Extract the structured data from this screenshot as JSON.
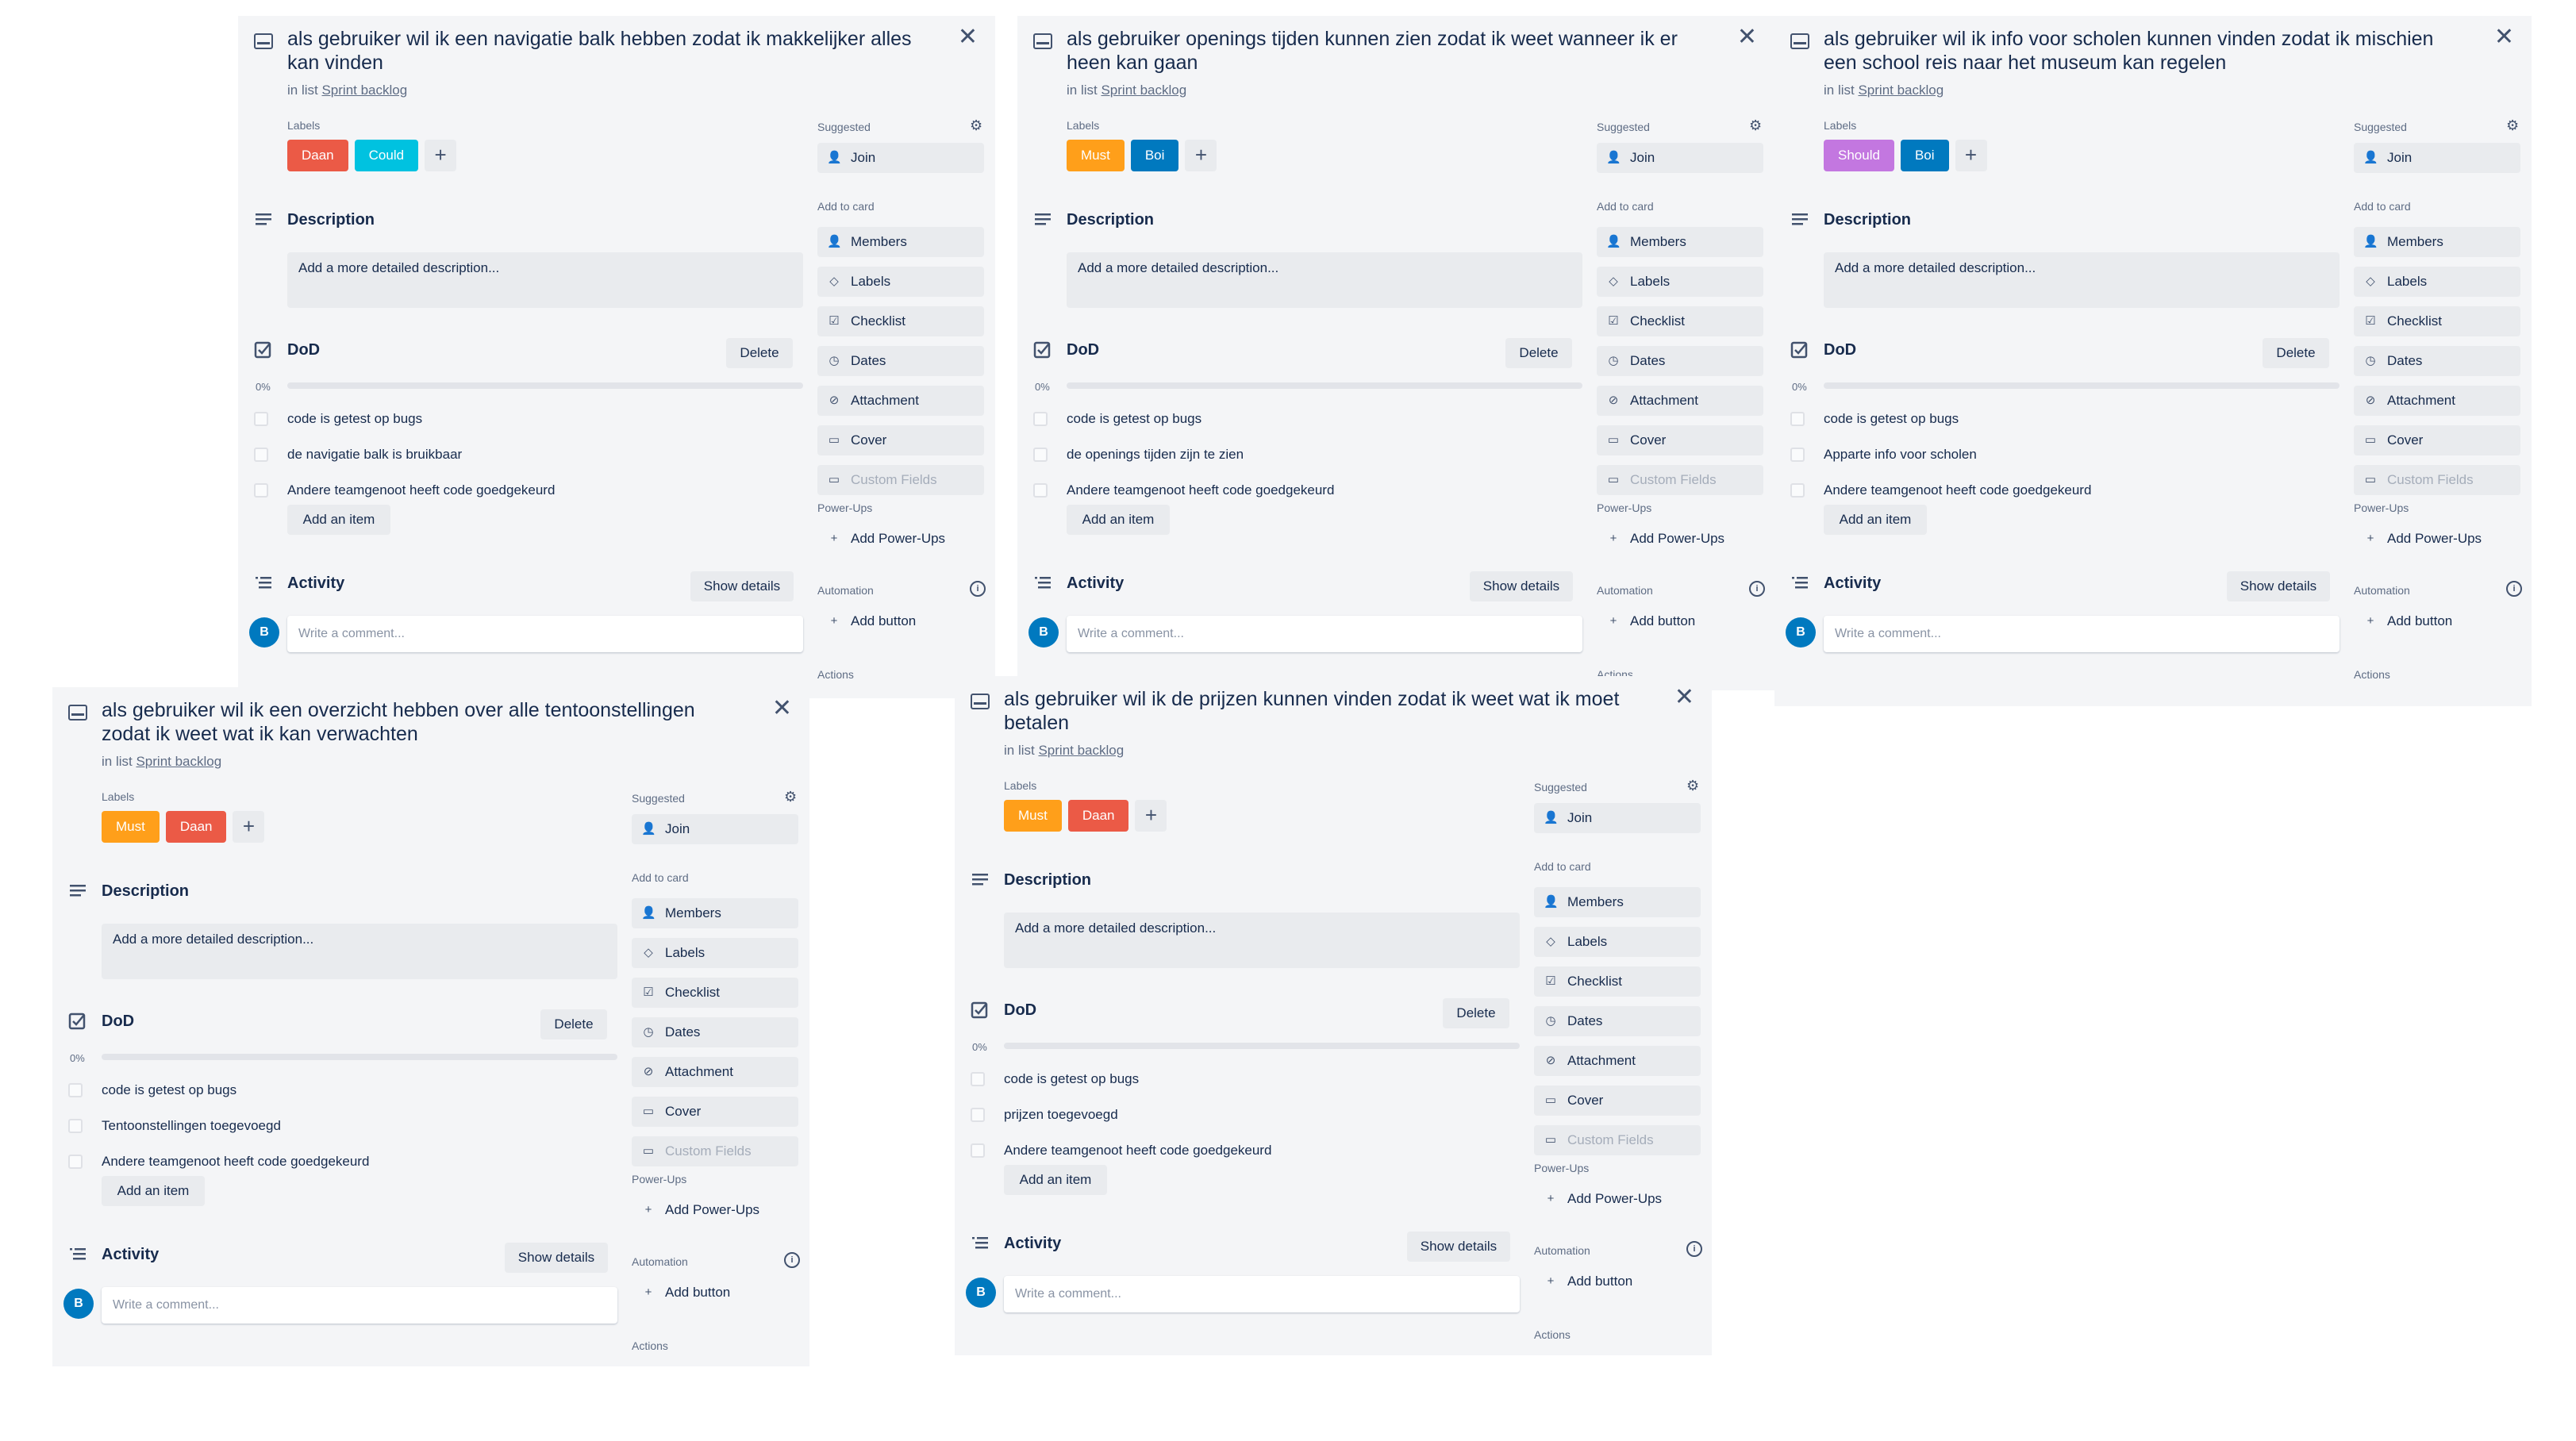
{
  "colors": {
    "Daan": "#eb5a46",
    "Could": "#00c2e0",
    "Must": "#ff9f1a",
    "Boi": "#0079bf",
    "Should": "#c377e0"
  },
  "cards": [
    {
      "title": "als gebruiker wil ik een navigatie balk hebben zodat ik makkelijker alles kan vinden",
      "list_prefix": "in list",
      "list_name": "Sprint backlog",
      "labels_caption": "Labels",
      "labels": [
        "Daan",
        "Could"
      ],
      "description_title": "Description",
      "description_placeholder": "Add a more detailed description...",
      "checklist_title": "DoD",
      "delete_label": "Delete",
      "progress_text": "0%",
      "progress": 0,
      "items": [
        "code is getest op bugs",
        "de navigatie balk is bruikbaar",
        "Andere teamgenoot heeft code goedgekeurd"
      ],
      "add_item": "Add an item",
      "activity_title": "Activity",
      "show_details": "Show details",
      "avatar": "B",
      "comment_placeholder": "Write a comment...",
      "side": {
        "suggested": "Suggested",
        "join": "Join",
        "add_to_card": "Add to card",
        "buttons": [
          "Members",
          "Labels",
          "Checklist",
          "Dates",
          "Attachment",
          "Cover",
          "Custom Fields"
        ],
        "powerups": "Power-Ups",
        "add_powerups": "Add Power-Ups",
        "automation": "Automation",
        "add_button": "Add button",
        "actions": "Actions"
      }
    },
    {
      "title": "als gebruiker openings tijden kunnen zien zodat ik weet wanneer ik er heen kan gaan",
      "list_prefix": "in list",
      "list_name": "Sprint backlog",
      "labels_caption": "Labels",
      "labels": [
        "Must",
        "Boi"
      ],
      "description_title": "Description",
      "description_placeholder": "Add a more detailed description...",
      "checklist_title": "DoD",
      "delete_label": "Delete",
      "progress_text": "0%",
      "progress": 0,
      "items": [
        "code is getest op bugs",
        "de openings tijden zijn te zien",
        "Andere teamgenoot heeft code goedgekeurd"
      ],
      "add_item": "Add an item",
      "activity_title": "Activity",
      "show_details": "Show details",
      "avatar": "B",
      "comment_placeholder": "Write a comment...",
      "side": {
        "suggested": "Suggested",
        "join": "Join",
        "add_to_card": "Add to card",
        "buttons": [
          "Members",
          "Labels",
          "Checklist",
          "Dates",
          "Attachment",
          "Cover",
          "Custom Fields"
        ],
        "powerups": "Power-Ups",
        "add_powerups": "Add Power-Ups",
        "automation": "Automation",
        "add_button": "Add button",
        "actions": "Actions"
      }
    },
    {
      "title": "als gebruiker wil ik info voor scholen kunnen vinden zodat ik mischien een school reis naar het museum kan regelen",
      "list_prefix": "in list",
      "list_name": "Sprint backlog",
      "labels_caption": "Labels",
      "labels": [
        "Should",
        "Boi"
      ],
      "description_title": "Description",
      "description_placeholder": "Add a more detailed description...",
      "checklist_title": "DoD",
      "delete_label": "Delete",
      "progress_text": "0%",
      "progress": 0,
      "items": [
        "code is getest op bugs",
        "Apparte info voor scholen",
        "Andere teamgenoot heeft code goedgekeurd"
      ],
      "add_item": "Add an item",
      "activity_title": "Activity",
      "show_details": "Show details",
      "avatar": "B",
      "comment_placeholder": "Write a comment...",
      "side": {
        "suggested": "Suggested",
        "join": "Join",
        "add_to_card": "Add to card",
        "buttons": [
          "Members",
          "Labels",
          "Checklist",
          "Dates",
          "Attachment",
          "Cover",
          "Custom Fields"
        ],
        "powerups": "Power-Ups",
        "add_powerups": "Add Power-Ups",
        "automation": "Automation",
        "add_button": "Add button",
        "actions": "Actions"
      }
    },
    {
      "title": "als gebruiker wil ik een overzicht hebben over alle tentoonstellingen zodat ik weet wat ik kan verwachten",
      "list_prefix": "in list",
      "list_name": "Sprint backlog",
      "labels_caption": "Labels",
      "labels": [
        "Must",
        "Daan"
      ],
      "description_title": "Description",
      "description_placeholder": "Add a more detailed description...",
      "checklist_title": "DoD",
      "delete_label": "Delete",
      "progress_text": "0%",
      "progress": 0,
      "items": [
        "code is getest op bugs",
        "Tentoonstellingen toegevoegd",
        "Andere teamgenoot heeft code goedgekeurd"
      ],
      "add_item": "Add an item",
      "activity_title": "Activity",
      "show_details": "Show details",
      "avatar": "B",
      "comment_placeholder": "Write a comment...",
      "side": {
        "suggested": "Suggested",
        "join": "Join",
        "add_to_card": "Add to card",
        "buttons": [
          "Members",
          "Labels",
          "Checklist",
          "Dates",
          "Attachment",
          "Cover",
          "Custom Fields"
        ],
        "powerups": "Power-Ups",
        "add_powerups": "Add Power-Ups",
        "automation": "Automation",
        "add_button": "Add button",
        "actions": "Actions"
      }
    },
    {
      "title": "als gebruiker wil ik de prijzen kunnen vinden zodat ik weet wat ik moet betalen",
      "list_prefix": "in list",
      "list_name": "Sprint backlog",
      "labels_caption": "Labels",
      "labels": [
        "Must",
        "Daan"
      ],
      "description_title": "Description",
      "description_placeholder": "Add a more detailed description...",
      "checklist_title": "DoD",
      "delete_label": "Delete",
      "progress_text": "0%",
      "progress": 0,
      "items": [
        "code is getest op bugs",
        "prijzen toegevoegd",
        "Andere teamgenoot heeft code goedgekeurd"
      ],
      "add_item": "Add an item",
      "activity_title": "Activity",
      "show_details": "Show details",
      "avatar": "B",
      "comment_placeholder": "Write a comment...",
      "side": {
        "suggested": "Suggested",
        "join": "Join",
        "add_to_card": "Add to card",
        "buttons": [
          "Members",
          "Labels",
          "Checklist",
          "Dates",
          "Attachment",
          "Cover",
          "Custom Fields"
        ],
        "powerups": "Power-Ups",
        "add_powerups": "Add Power-Ups",
        "automation": "Automation",
        "add_button": "Add button",
        "actions": "Actions"
      }
    }
  ]
}
